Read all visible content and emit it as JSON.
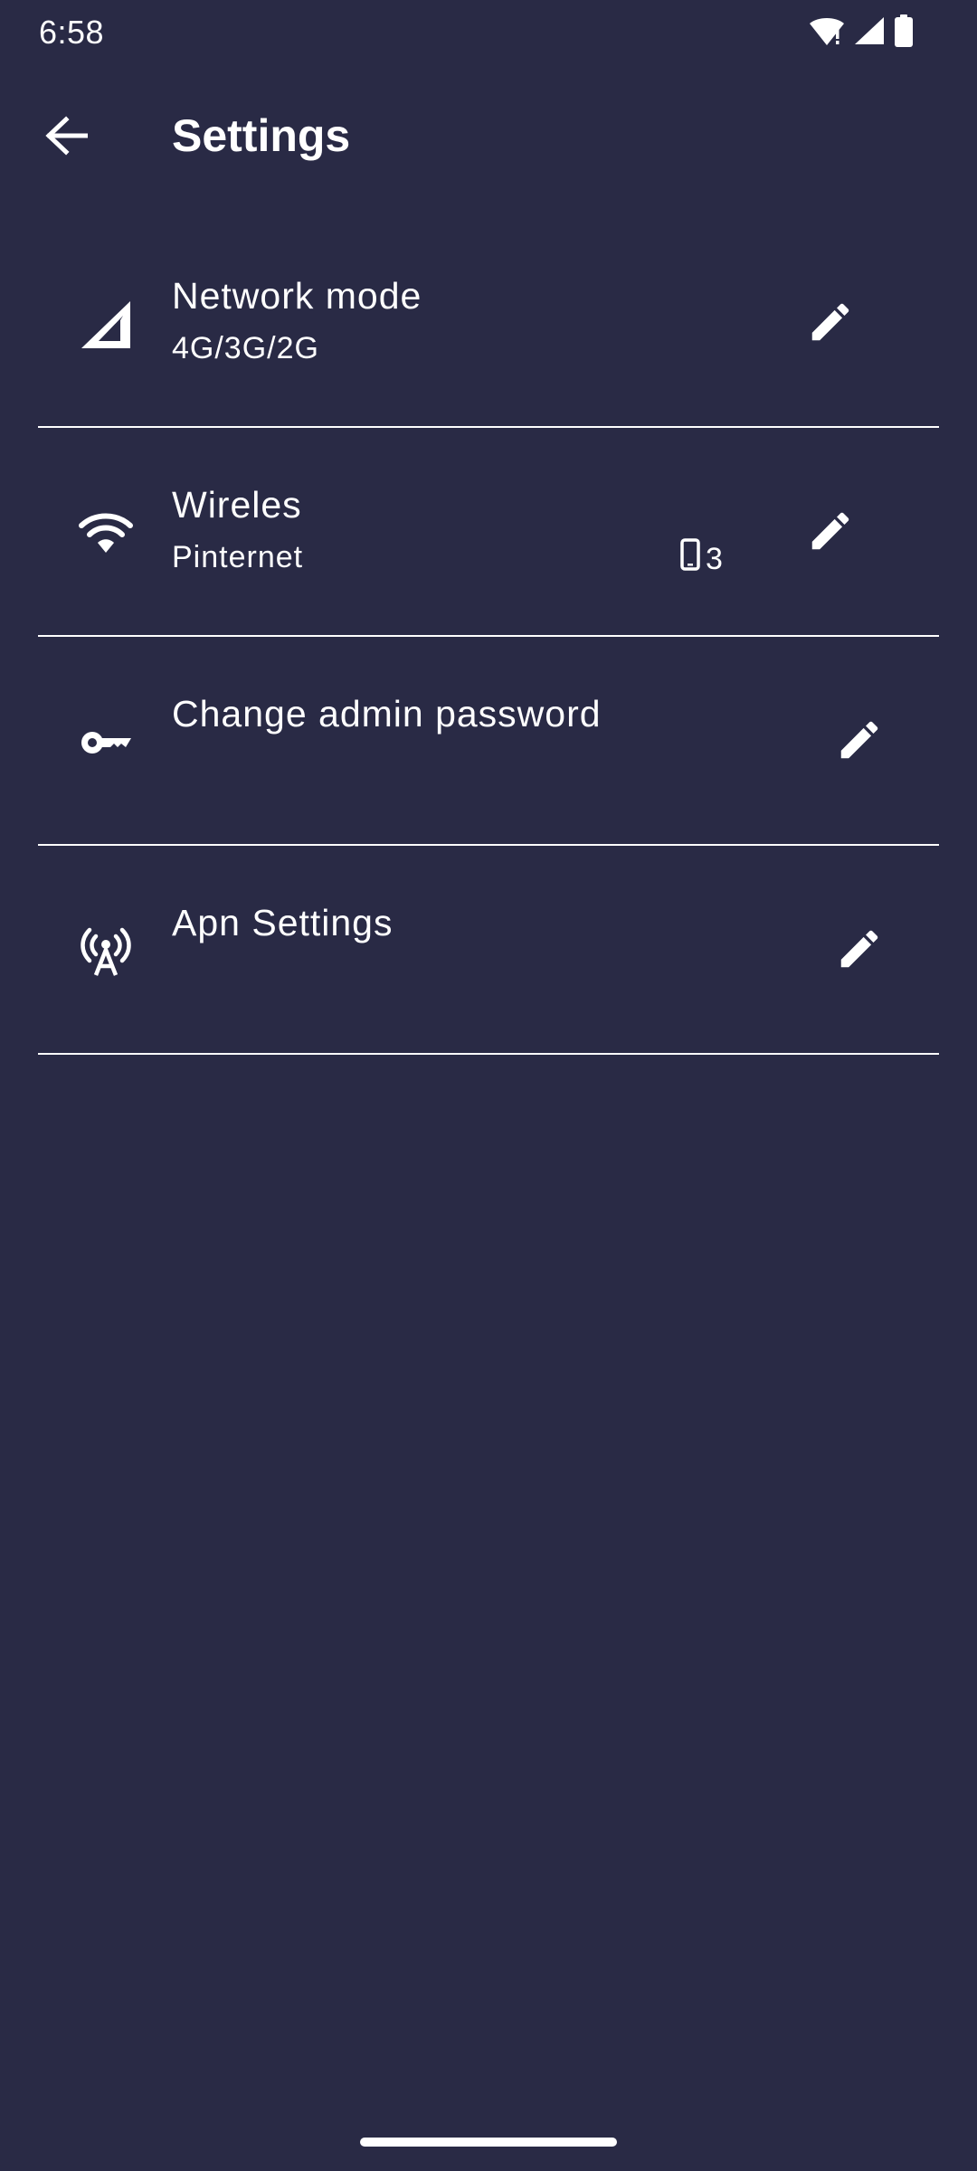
{
  "status_bar": {
    "time": "6:58",
    "icons": [
      "wifi-alert-icon",
      "cell-signal-icon",
      "battery-icon"
    ]
  },
  "app_bar": {
    "back_icon": "arrow-back-icon",
    "title": "Settings"
  },
  "settings": [
    {
      "icon": "signal-cellular-icon",
      "title": "Network mode",
      "subtitle": "4G/3G/2G",
      "edit_icon": "pencil-icon"
    },
    {
      "icon": "wifi-icon",
      "title": "Wireles",
      "subtitle": "Pinternet",
      "device_count": "3",
      "device_icon": "phone-icon",
      "edit_icon": "pencil-icon"
    },
    {
      "icon": "key-icon",
      "title": "Change admin password",
      "edit_icon": "pencil-icon"
    },
    {
      "icon": "antenna-icon",
      "title": "Apn Settings",
      "edit_icon": "pencil-icon"
    }
  ],
  "colors": {
    "background": "#292a45",
    "foreground": "#ffffff"
  }
}
